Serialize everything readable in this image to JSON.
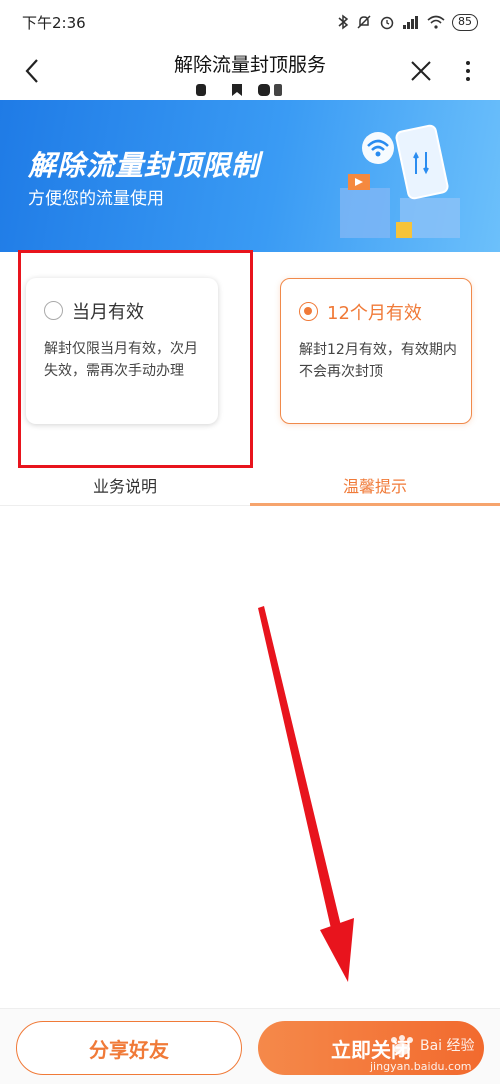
{
  "status_bar": {
    "time": "下午2:36",
    "battery": "85"
  },
  "nav": {
    "title": "解除流量封顶服务"
  },
  "banner": {
    "title": "解除流量封顶限制",
    "subtitle": "方便您的流量使用"
  },
  "plans": [
    {
      "label": "当月有效",
      "desc": "解封仅限当月有效，次月失效，需再次手动办理",
      "selected": false
    },
    {
      "label": "12个月有效",
      "desc": "解封12月有效，有效期内不会再次封顶",
      "selected": true
    }
  ],
  "tabs": [
    {
      "label": "业务说明",
      "active": false
    },
    {
      "label": "温馨提示",
      "active": true
    }
  ],
  "buttons": {
    "share": "分享好友",
    "close": "立即关闭"
  },
  "watermark": {
    "text": "jingyan.baidu.com",
    "logo_text": "Bai 经验"
  },
  "colors": {
    "accent": "#f07a38",
    "banner": "#2a8cf0",
    "highlight": "#e8141d"
  }
}
